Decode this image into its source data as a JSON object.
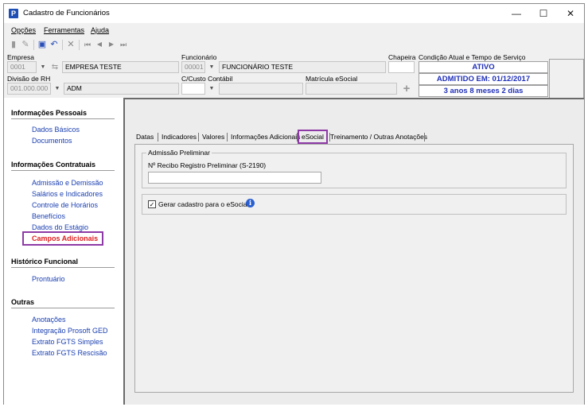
{
  "window": {
    "title": "Cadastro de Funcionários",
    "icon_letter": "P",
    "minimize": "—",
    "maximize": "☐",
    "close": "✕"
  },
  "menu": {
    "items": [
      {
        "label": "Opções"
      },
      {
        "label": "Ferramentas"
      },
      {
        "label": "Ajuda"
      }
    ]
  },
  "toolbar": {
    "icons": [
      "new-document-icon",
      "edit-icon",
      "save-icon",
      "undo-icon",
      "delete-icon",
      "first-record-icon",
      "previous-record-icon",
      "next-record-icon",
      "last-record-icon"
    ],
    "glyphs": {
      "new": "▮",
      "edit": "✎",
      "save": "▣",
      "undo": "↶",
      "delete": "✕",
      "first": "⏮",
      "prev": "◀",
      "next": "▶",
      "last": "⏭"
    }
  },
  "header": {
    "empresa_label": "Empresa",
    "empresa_code": "0001",
    "empresa_name": "EMPRESA TESTE",
    "funcionario_label": "Funcionário",
    "funcionario_code": "00001",
    "funcionario_name": "FUNCIONÁRIO TESTE",
    "chapeira_label": "Chapeira",
    "chapeira_value": "",
    "condicao_label": "Condição Atual e Tempo de Serviço",
    "status_ativo": "ATIVO",
    "status_admitido": "ADMITIDO EM: 01/12/2017",
    "status_tempo": "3 anos 8 meses 2 dias",
    "divisao_label": "Divisão de RH",
    "divisao_code": "001.000.000",
    "divisao_name": "ADM",
    "custo_label": "C/Custo Contábil",
    "custo_code": "",
    "custo_name": "",
    "matricula_label": "Matrícula eSocial",
    "matricula_value": "",
    "add_glyph": "+",
    "dropdown_glyph": "▼",
    "link_glyph": "⇆"
  },
  "sidebar": {
    "sections": [
      {
        "title": "Informações Pessoais",
        "items": [
          "Dados Básicos",
          "Documentos"
        ]
      },
      {
        "title": "Informações Contratuais",
        "items": [
          "Admissão e Demissão",
          "Salários e Indicadores",
          "Controle de Horários",
          "Benefícios",
          "Dados do Estágio",
          "Campos Adicionais"
        ]
      },
      {
        "title": "Histórico Funcional",
        "items": [
          "Prontuário"
        ]
      },
      {
        "title": "Outras",
        "items": [
          "Anotações",
          "Integração Prosoft GED",
          "Extrato FGTS Simples",
          "Extrato FGTS Rescisão"
        ]
      }
    ],
    "active_item": "Campos Adicionais"
  },
  "tabs": [
    {
      "label": "Datas"
    },
    {
      "label": "Indicadores"
    },
    {
      "label": "Valores"
    },
    {
      "label": "Informações Adicionais"
    },
    {
      "label": "eSocial"
    },
    {
      "label": "Treinamento / Outras Anotações"
    }
  ],
  "active_tab": "eSocial",
  "esocial": {
    "group_title": "Admissão Preliminar",
    "recibo_label": "Nº Recibo Registro Preliminar (S-2190)",
    "recibo_value": "",
    "gerar_label": "Gerar cadastro para o eSocial?",
    "gerar_checked": true,
    "check_glyph": "✓",
    "info_glyph": "i"
  },
  "colors": {
    "status_text": "#1f2fb8",
    "link": "#1a3fb0",
    "active_link": "#e02020",
    "highlight": "#8e3aa6"
  }
}
